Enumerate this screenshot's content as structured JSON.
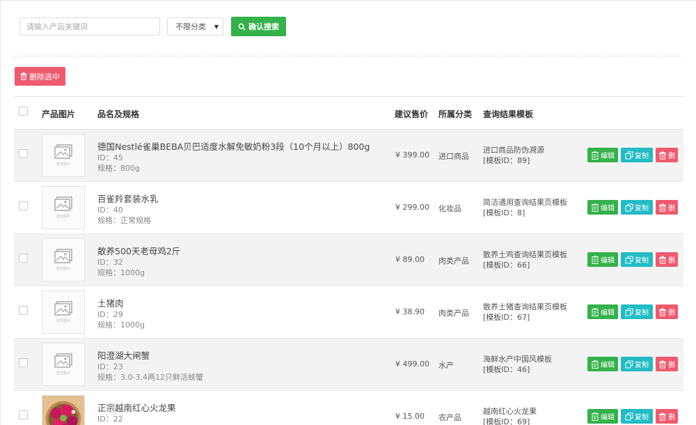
{
  "search": {
    "placeholder": "请输入产品关键词",
    "category_selected": "不限分类",
    "confirm_label": "确认搜索"
  },
  "toolbar": {
    "delete_selected_label": "删除选中"
  },
  "table": {
    "headers": {
      "image": "产品图片",
      "name": "品名及规格",
      "price": "建议售价",
      "category": "所属分类",
      "template": "查询结果模板"
    },
    "placeholder_caption": "暂无图片",
    "action_labels": {
      "edit": "编辑",
      "copy": "复制",
      "delete": "删"
    },
    "rows": [
      {
        "name": "德国Nestlé雀巢BEBA贝巴适度水解免敏奶粉3段（10个月以上）800g",
        "id": "ID：45",
        "spec": "规格：800g",
        "price": "¥ 399.00",
        "category": "进口商品",
        "template_name": "进口商品防伪溯源",
        "template_id": "[模板ID：89]"
      },
      {
        "name": "百雀羚套装水乳",
        "id": "ID：40",
        "spec": "规格：正常规格",
        "price": "¥ 299.00",
        "category": "化妆品",
        "template_name": "简洁通用查询结果页模板",
        "template_id": "[模板ID：8]"
      },
      {
        "name": "散养500天老母鸡2斤",
        "id": "ID：32",
        "spec": "规格：1000g",
        "price": "¥ 89.00",
        "category": "肉类产品",
        "template_name": "散养土鸡查询结果页模板",
        "template_id": "[模板ID：66]"
      },
      {
        "name": "土猪肉",
        "id": "ID：29",
        "spec": "规格：1000g",
        "price": "¥ 38.90",
        "category": "肉类产品",
        "template_name": "散养土猪查询结果页模板",
        "template_id": "[模板ID：67]"
      },
      {
        "name": "阳澄湖大闸蟹",
        "id": "ID：23",
        "spec": "规格：3.0-3.4两12只鲜活螃蟹",
        "price": "¥ 499.00",
        "category": "水产",
        "template_name": "海鲜水产中国风模板",
        "template_id": "[模板ID：46]"
      },
      {
        "name": "正宗越南红心火龙果",
        "id": "ID：22",
        "spec": "",
        "price": "¥ 15.00",
        "category": "农产品",
        "template_name": "越南红心火龙果",
        "template_id": "[模板ID：69]"
      }
    ]
  },
  "colors": {
    "green": "#34b14a",
    "cyan": "#22bcc4",
    "red": "#ef5a6f",
    "row_alt": "#f3f3f3"
  },
  "icons": {
    "search": "search-icon",
    "trash": "trash-icon",
    "edit": "edit-icon",
    "copy": "copy-icon",
    "image_placeholder": "image-placeholder-icon"
  }
}
